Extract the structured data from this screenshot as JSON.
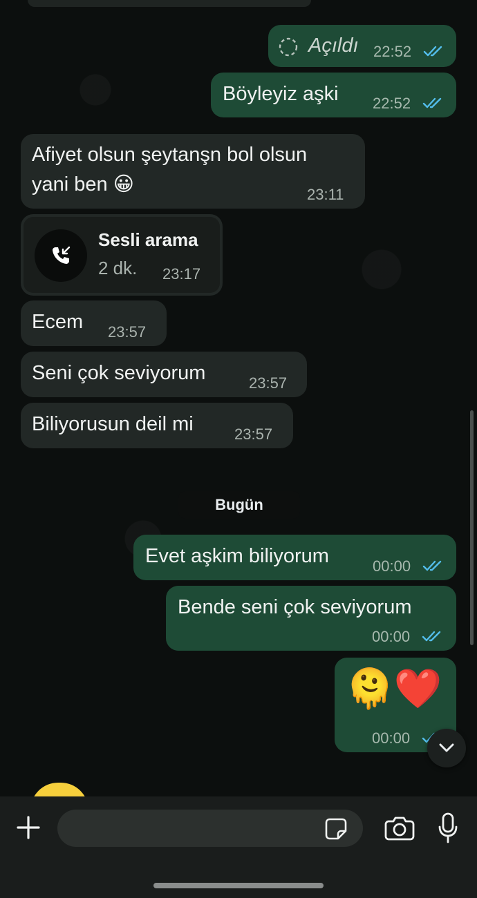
{
  "chat": {
    "messages": [
      {
        "id": "m1",
        "direction": "outgoing",
        "text": "Açıldı",
        "time": "22:52",
        "status": "read"
      },
      {
        "id": "m2",
        "direction": "outgoing",
        "text": "Böyleyiz aşki",
        "time": "22:52",
        "status": "read"
      },
      {
        "id": "m3",
        "direction": "incoming",
        "line1": "Afiyet olsun şeytanşn bol olsun",
        "line2": "yani ben 😀",
        "time": "23:11"
      },
      {
        "id": "m4",
        "direction": "incoming",
        "type": "call",
        "title": "Sesli arama",
        "duration": "2 dk.",
        "time": "23:17"
      },
      {
        "id": "m5",
        "direction": "incoming",
        "text": "Ecem",
        "time": "23:57"
      },
      {
        "id": "m6",
        "direction": "incoming",
        "text": "Seni çok seviyorum",
        "time": "23:57"
      },
      {
        "id": "m7",
        "direction": "incoming",
        "text": "Biliyorusun deil mi",
        "time": "23:57"
      },
      {
        "id": "m8",
        "direction": "outgoing",
        "text": "Evet aşkim biliyorum",
        "time": "00:00",
        "status": "read"
      },
      {
        "id": "m9",
        "direction": "outgoing",
        "text": "Bende seni çok seviyorum",
        "time": "00:00",
        "status": "read"
      },
      {
        "id": "m10",
        "direction": "outgoing",
        "text": "🫠❤️",
        "time": "00:00",
        "status": "read"
      }
    ],
    "date_separator": "Bugün"
  },
  "composer": {
    "placeholder": "",
    "icons": [
      "plus-icon",
      "sticker-icon",
      "camera-icon",
      "microphone-icon"
    ]
  },
  "colors": {
    "outgoing_bubble": "#1e4b36",
    "incoming_bubble": "#222826",
    "read_ticks": "#53bdeb",
    "background": "#0c0f0e"
  }
}
